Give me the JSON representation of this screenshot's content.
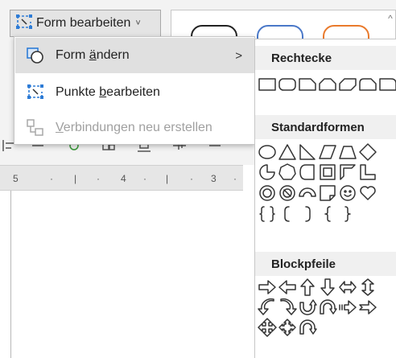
{
  "ribbon": {
    "form_button_label": "Form bearbeiten",
    "form_button_chevron": "˅",
    "gallery_scroll": "^",
    "style_colors": [
      "#222222",
      "#4a78c8",
      "#e97a2c"
    ]
  },
  "ruler": {
    "ticks": [
      "5",
      "·",
      "|",
      "·",
      "4",
      "·",
      "|",
      "·",
      "3",
      "·"
    ]
  },
  "menu": {
    "change_shape": {
      "pre": "Form ",
      "mn": "ä",
      "post": "ndern",
      "arrow": ">"
    },
    "edit_points": {
      "pre": "Punkte ",
      "mn": "b",
      "post": "earbeiten"
    },
    "reroute": {
      "pre": "",
      "mn": "V",
      "post": "erbindungen neu erstellen",
      "disabled": true
    }
  },
  "panel": {
    "rect_header": "Rechtecke",
    "basic_header": "Standardformen",
    "block_header": "Blockpfeile"
  },
  "icons": {
    "accent": "#2e7cd6"
  }
}
